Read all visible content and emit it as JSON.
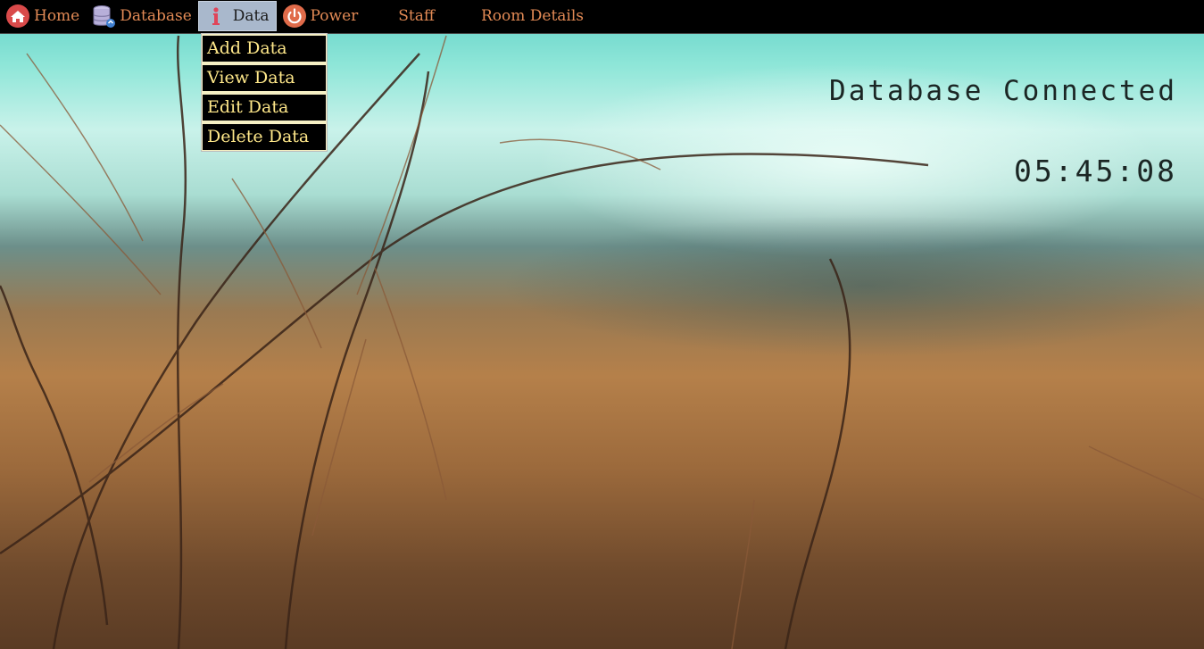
{
  "menu": {
    "home": "Home",
    "database": "Database",
    "data": "Data",
    "power": "Power",
    "staff": "Staff",
    "room_details": "Room Details"
  },
  "data_dropdown": {
    "items": [
      "Add Data",
      "View Data",
      "Edit Data",
      "Delete Data"
    ]
  },
  "status": {
    "text": "Database Connected",
    "clock": "05:45:08"
  },
  "colors": {
    "menu_text": "#e28a55",
    "dropdown_text": "#ffe88a",
    "active_menu_bg": "#a9b8cc"
  },
  "icons": {
    "home": "home-icon",
    "database": "database-icon",
    "data": "info-icon",
    "power": "power-icon"
  }
}
